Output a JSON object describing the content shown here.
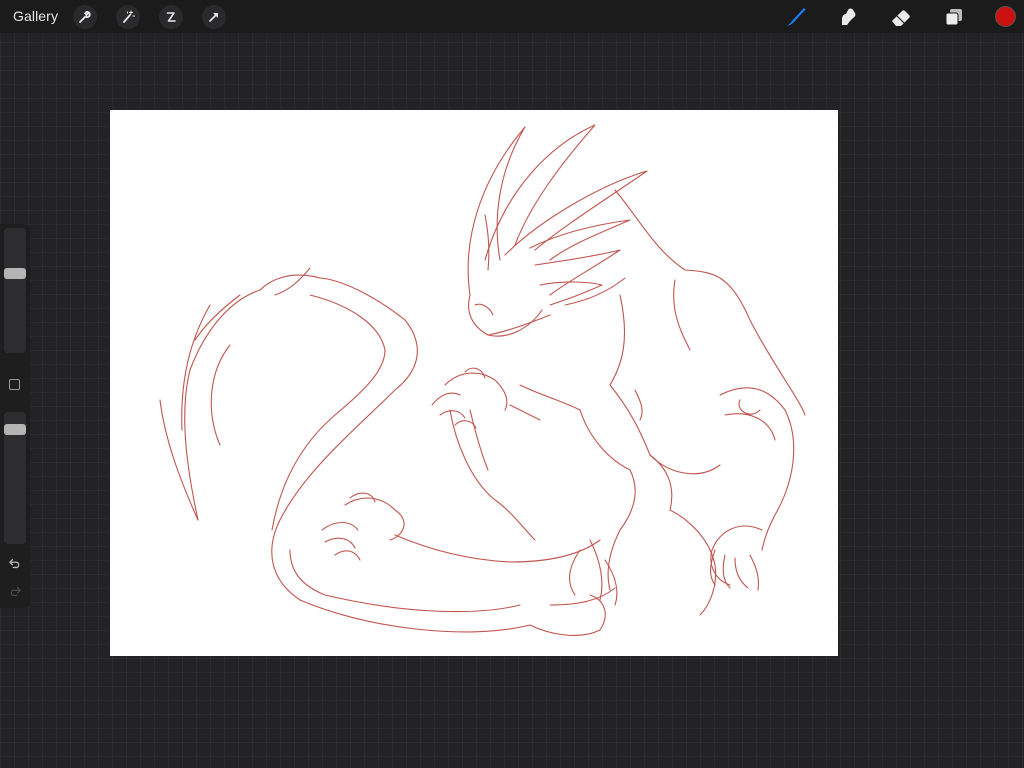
{
  "topbar": {
    "gallery_label": "Gallery",
    "left_tools": [
      "wrench-icon",
      "magic-wand-icon",
      "selection-icon",
      "transform-arrow-icon"
    ],
    "right_tools": [
      "brush-icon",
      "smudge-icon",
      "eraser-icon",
      "layers-icon"
    ],
    "active_tool": "brush-icon",
    "accent_color": "#1a82f7",
    "current_color": "#cc1111"
  },
  "sidebar": {
    "brush_size_level": 0.65,
    "opacity_level": 0.9,
    "controls": [
      "modify-square-icon",
      "undo-icon",
      "redo-icon"
    ]
  },
  "canvas": {
    "background": "#ffffff",
    "sketch_stroke_color": "#c0554f",
    "sketch_subject": "dragon-sketch"
  }
}
